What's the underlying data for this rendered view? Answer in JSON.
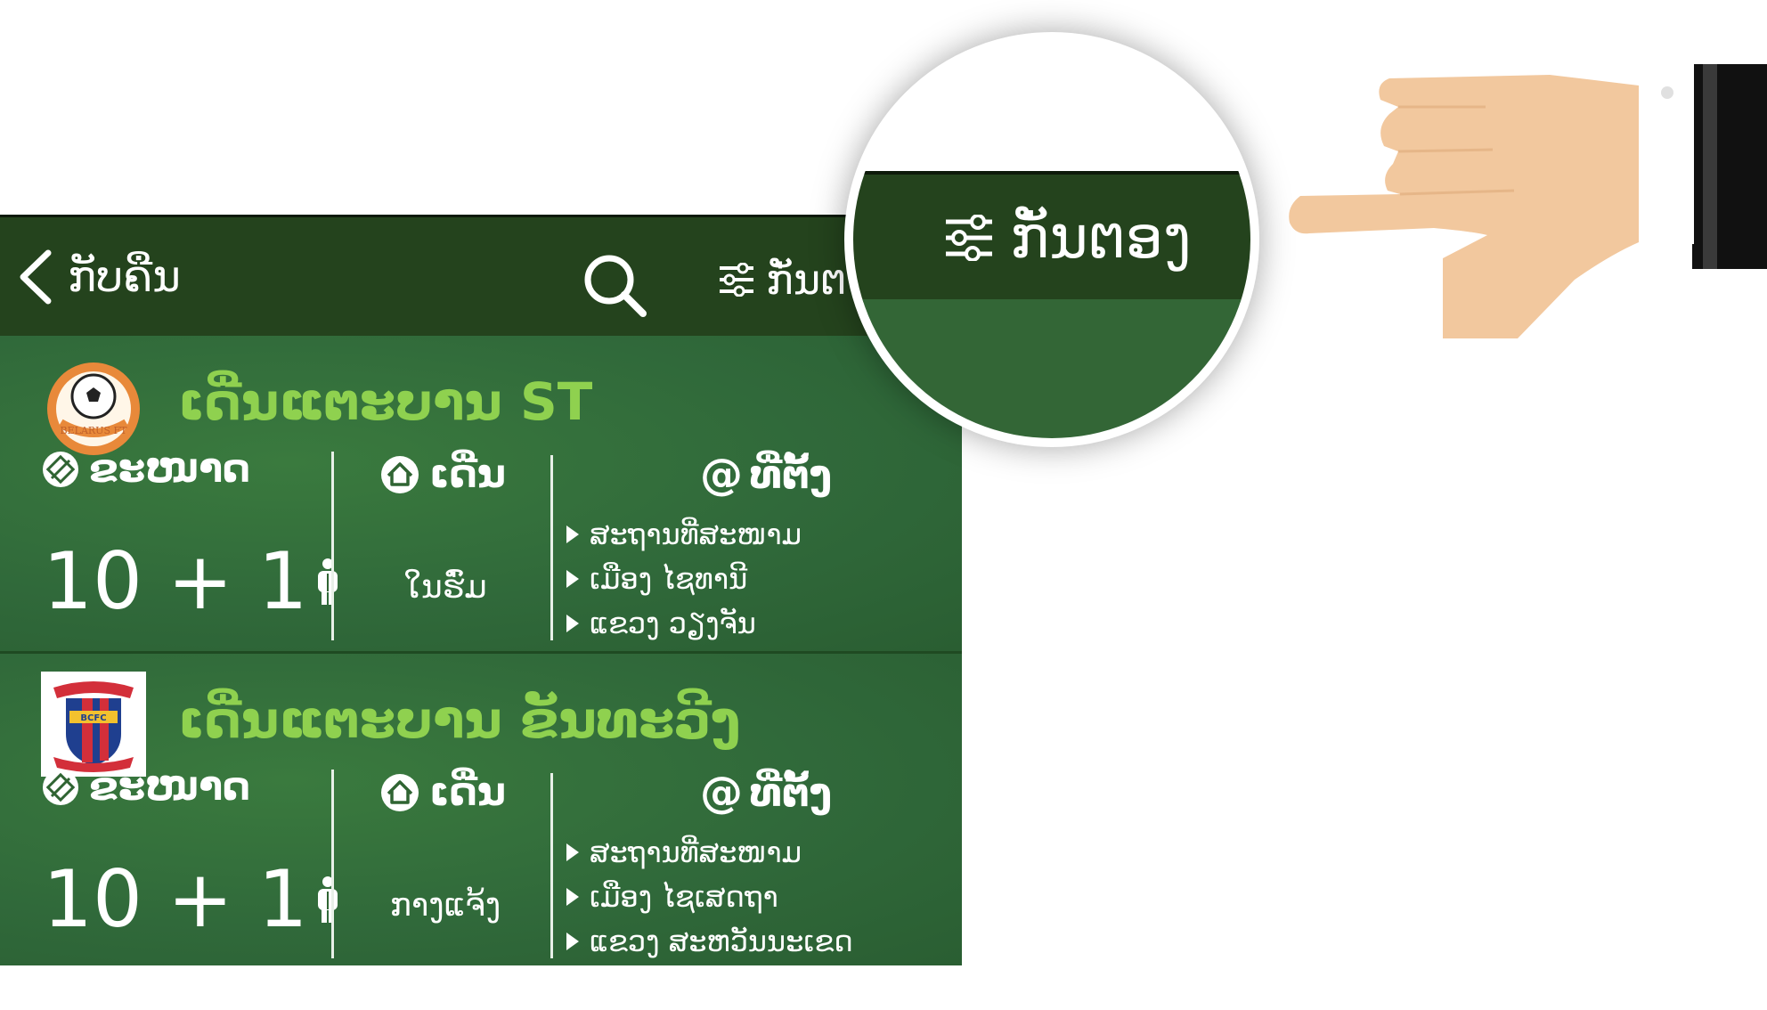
{
  "header": {
    "back_label": "ກັບຄືນ",
    "filter_label": "ກັ່ນຕອງ",
    "filter_label_partial": "ກັ່ນຕ"
  },
  "magnifier": {
    "filter_label": "ກັ່ນຕອງ"
  },
  "labels": {
    "size": "ຂະໜາດ",
    "field": "ເດີ່ນ",
    "location": "ທີ່ຕັ້ງ"
  },
  "fields": [
    {
      "name": "ເດີ່ນແຕະບານ ST",
      "logo_text": "BELARUS FT",
      "size": "10 + 1",
      "field_type": "ໃນຮົ່ມ",
      "locations": [
        "ສະຖານທີ່ສະໜາມ",
        "ເມືອງ ໄຊທານີ",
        "ແຂວງ ວຽງຈັນ"
      ]
    },
    {
      "name": "ເດີ່ນແຕະບານ ຂັນທະວີງ",
      "logo_text": "BCFC",
      "size": "10 + 1",
      "field_type": "ກາງແຈ້ງ",
      "locations": [
        "ສະຖານທີ່ສະໜາມ",
        "ເມືອງ ໄຊເສດຖາ",
        "ແຂວງ ສະຫວັນນະເຂດ"
      ]
    }
  ],
  "colors": {
    "topbar": "#24431d",
    "card": "#30693a",
    "title": "#8fd14f",
    "hand_skin": "#f2c89e",
    "sleeve": "#111111"
  }
}
